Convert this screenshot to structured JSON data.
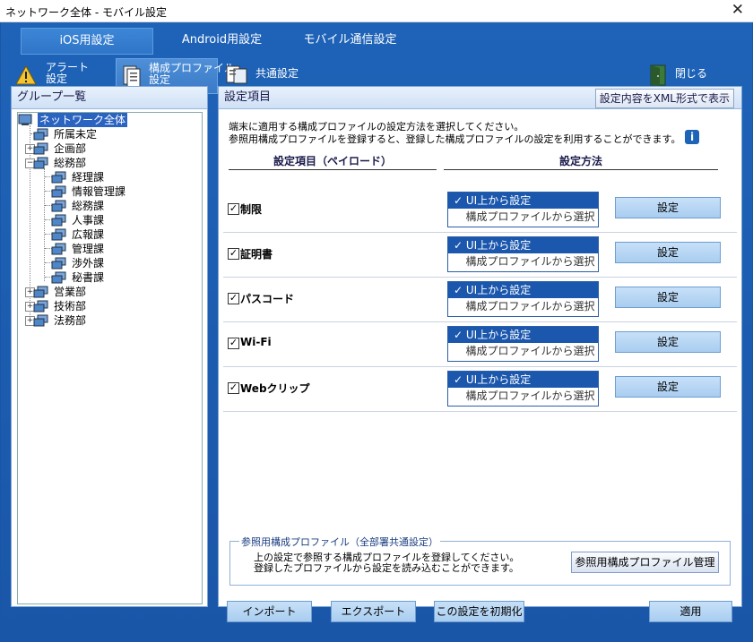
{
  "window": {
    "title": "ネットワーク全体 - モバイル設定",
    "close": "✕"
  },
  "tabs": [
    {
      "label": "iOS用設定",
      "active": true
    },
    {
      "label": "Android用設定",
      "active": false
    },
    {
      "label": "モバイル通信設定",
      "active": false
    }
  ],
  "toolbar": {
    "alert": "アラート\n設定",
    "profile": "構成プロファイル\n設定",
    "common": "共通設定",
    "close": "閉じる"
  },
  "group_panel": {
    "title": "グループ一覧",
    "tree": [
      {
        "label": "ネットワーク全体",
        "selected": true
      },
      {
        "label": "所属未定"
      },
      {
        "label": "企画部",
        "expander": "+"
      },
      {
        "label": "総務部",
        "expander": "−"
      },
      {
        "label": "経理課"
      },
      {
        "label": "情報管理課"
      },
      {
        "label": "総務課"
      },
      {
        "label": "人事課"
      },
      {
        "label": "広報課"
      },
      {
        "label": "管理課"
      },
      {
        "label": "渉外課"
      },
      {
        "label": "秘書課"
      },
      {
        "label": "営業部",
        "expander": "+"
      },
      {
        "label": "技術部",
        "expander": "+"
      },
      {
        "label": "法務部",
        "expander": "+"
      }
    ]
  },
  "settings": {
    "title": "設定項目",
    "xml_button": "設定内容をXML形式で表示",
    "description": "端末に適用する構成プロファイルの設定方法を選択してください。\n参照用構成プロファイルを登録すると、登録した構成プロファイルの設定を利用することができます。",
    "info_icon": "i",
    "col_item": "設定項目（ペイロード）",
    "col_method": "設定方法",
    "rows": [
      {
        "name": "制限",
        "checked": "✓",
        "opt_ui": "✓  UI上から設定",
        "opt_profile": "構成プロファイルから選択",
        "button": "設定"
      },
      {
        "name": "証明書",
        "checked": "✓",
        "opt_ui": "✓  UI上から設定",
        "opt_profile": "構成プロファイルから選択",
        "button": "設定"
      },
      {
        "name": "パスコード",
        "checked": "✓",
        "opt_ui": "✓  UI上から設定",
        "opt_profile": "構成プロファイルから選択",
        "button": "設定"
      },
      {
        "name": "Wi-Fi",
        "checked": "✓",
        "opt_ui": "✓  UI上から設定",
        "opt_profile": "構成プロファイルから選択",
        "button": "設定"
      },
      {
        "name": "Webクリップ",
        "checked": "✓",
        "opt_ui": "✓  UI上から設定",
        "opt_profile": "構成プロファイルから選択",
        "button": "設定"
      }
    ],
    "reference": {
      "legend": "参照用構成プロファイル（全部署共通設定）",
      "text": "上の設定で参照する構成プロファイルを登録してください。\n登録したプロファイルから設定を読み込むことができます。",
      "button": "参照用構成プロファイル管理"
    },
    "buttons": {
      "import": "インポート",
      "export": "エクスポート",
      "reset": "この設定を初期化",
      "apply": "適用"
    }
  }
}
